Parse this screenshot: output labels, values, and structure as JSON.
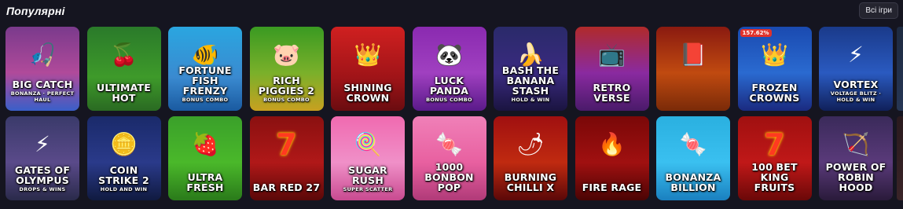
{
  "header": {
    "title": "Популярні",
    "all_games_label": "Всі ігри"
  },
  "games_row1": [
    {
      "name": "Big Catch",
      "sub": "Bonanza · Perfect Haul",
      "icon": "fisherman-icon",
      "glyph": "🎣",
      "bg": "linear-gradient(180deg,#7a3a8c 0%,#b04a9a 55%,#3a5fc8 100%)"
    },
    {
      "name": "Ultimate Hot",
      "sub": "",
      "icon": "cherry-icon",
      "glyph": "🍒",
      "bg": "linear-gradient(180deg,#2a7a2a 0%,#3e9a2a 60%,#2a6a22 100%)"
    },
    {
      "name": "Fortune Fish Frenzy",
      "sub": "Bonus Combo",
      "icon": "fish-icon",
      "glyph": "🐠",
      "bg": "linear-gradient(180deg,#2aa6e0 0%,#3a8ad0 60%,#1a5aa0 100%)"
    },
    {
      "name": "Rich Piggies 2",
      "sub": "Bonus Combo",
      "icon": "piggy-bank-icon",
      "glyph": "🐷",
      "bg": "linear-gradient(180deg,#3a9a22 0%,#7ab02a 55%,#c8a020 100%)"
    },
    {
      "name": "Shining Crown",
      "sub": "",
      "icon": "crown-icon",
      "glyph": "👑",
      "bg": "linear-gradient(180deg,#d02020 0%,#a01418 60%,#6a0c10 100%)"
    },
    {
      "name": "Luck Panda",
      "sub": "Bonus Combo",
      "icon": "panda-icon",
      "glyph": "🐼",
      "bg": "linear-gradient(180deg,#8a2ab0 0%,#a040c0 55%,#5a1a8a 100%)"
    },
    {
      "name": "Bash the Banana Stash",
      "sub": "Hold & Win",
      "icon": "banana-icon",
      "glyph": "🍌",
      "bg": "linear-gradient(180deg,#2a2a6a 0%,#3a2a80 55%,#1a1440 100%)"
    },
    {
      "name": "Retro Verse",
      "sub": "",
      "icon": "retro-tv-icon",
      "glyph": "📺",
      "bg": "linear-gradient(180deg,#b02a2a 0%,#8a2aa0 55%,#4a1a6a 100%)"
    },
    {
      "name": "",
      "sub": "",
      "icon": "treasure-book-icon",
      "glyph": "📕",
      "bg": "linear-gradient(180deg,#8a1a10 0%,#c04a10 55%,#7a2a08 100%)"
    },
    {
      "name": "Frozen Crowns",
      "sub": "",
      "icon": "crown-icon",
      "glyph": "👑",
      "bg": "linear-gradient(180deg,#1a4ab0 0%,#2a6ad0 55%,#1a2a80 100%)",
      "badge": "157.62%"
    },
    {
      "name": "Vortex",
      "sub": "Voltage Blitz · Hold & Win",
      "icon": "lightning-icon",
      "glyph": "⚡",
      "bg": "linear-gradient(180deg,#1a3a8a 0%,#2a5ac0 55%,#10205a 100%)"
    }
  ],
  "games_row2": [
    {
      "name": "Gates of Olympus",
      "sub": "Drops & Wins",
      "icon": "zeus-icon",
      "glyph": "⚡",
      "bg": "linear-gradient(180deg,#3a3a6a 0%,#5a4a8a 55%,#2a2a4a 100%)"
    },
    {
      "name": "Coin Strike 2",
      "sub": "Hold and Win",
      "icon": "coin-icon",
      "glyph": "🪙",
      "bg": "linear-gradient(180deg,#1a2a6a 0%,#2a3a8a 55%,#101a40 100%)"
    },
    {
      "name": "Ultra Fresh",
      "sub": "",
      "icon": "strawberry-icon",
      "glyph": "🍓",
      "bg": "linear-gradient(180deg,#3aa02a 0%,#4ab82a 55%,#2a7a1a 100%)"
    },
    {
      "name": "Bar Red 27",
      "sub": "",
      "icon": "seven-icon",
      "glyph": "7",
      "bg": "linear-gradient(180deg,#8a1010 0%,#b01818 55%,#5a0808 100%)"
    },
    {
      "name": "Sugar Rush",
      "sub": "Super Scatter",
      "icon": "lollipop-icon",
      "glyph": "🍭",
      "bg": "linear-gradient(180deg,#f06ab0 0%,#f090c8 55%,#c84a90 100%)"
    },
    {
      "name": "1000 Bonbon Pop",
      "sub": "",
      "icon": "candy-icon",
      "glyph": "🍬",
      "bg": "linear-gradient(180deg,#f080b8 0%,#e860a0 55%,#b03a78 100%)"
    },
    {
      "name": "Burning Chilli X",
      "sub": "",
      "icon": "chilli-icon",
      "glyph": "🌶",
      "bg": "linear-gradient(180deg,#a01010 0%,#c02a10 55%,#5a0808 100%)"
    },
    {
      "name": "Fire Rage",
      "sub": "",
      "icon": "fire-icon",
      "glyph": "🔥",
      "bg": "linear-gradient(180deg,#7a0808 0%,#a01010 55%,#4a0404 100%)"
    },
    {
      "name": "Bonanza Billion",
      "sub": "",
      "icon": "candy-icon",
      "glyph": "🍬",
      "bg": "linear-gradient(180deg,#2ab0e0 0%,#3ac0f0 55%,#1a80c0 100%)"
    },
    {
      "name": "100 Bet King Fruits",
      "sub": "",
      "icon": "seven-icon",
      "glyph": "7",
      "bg": "linear-gradient(180deg,#a01010 0%,#c01818 55%,#6a0808 100%)"
    },
    {
      "name": "Power of Robin Hood",
      "sub": "",
      "icon": "archer-icon",
      "glyph": "🏹",
      "bg": "linear-gradient(180deg,#3a2a5a 0%,#5a3a7a 55%,#2a1a3a 100%)"
    }
  ]
}
